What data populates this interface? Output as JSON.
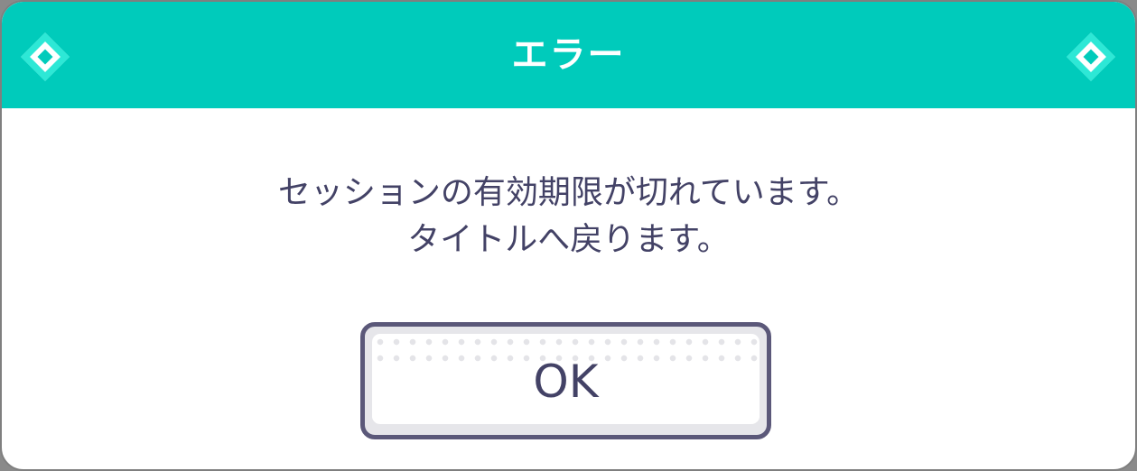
{
  "dialog": {
    "title": "エラー",
    "message_line1": "セッションの有効期限が切れています。",
    "message_line2": "タイトルへ戻ります。",
    "ok_label": "OK"
  },
  "colors": {
    "header": "#00cbbb",
    "text": "#434266",
    "button_border": "#5b5879"
  },
  "icons": {
    "header_left": "diamond-icon",
    "header_right": "diamond-icon"
  }
}
